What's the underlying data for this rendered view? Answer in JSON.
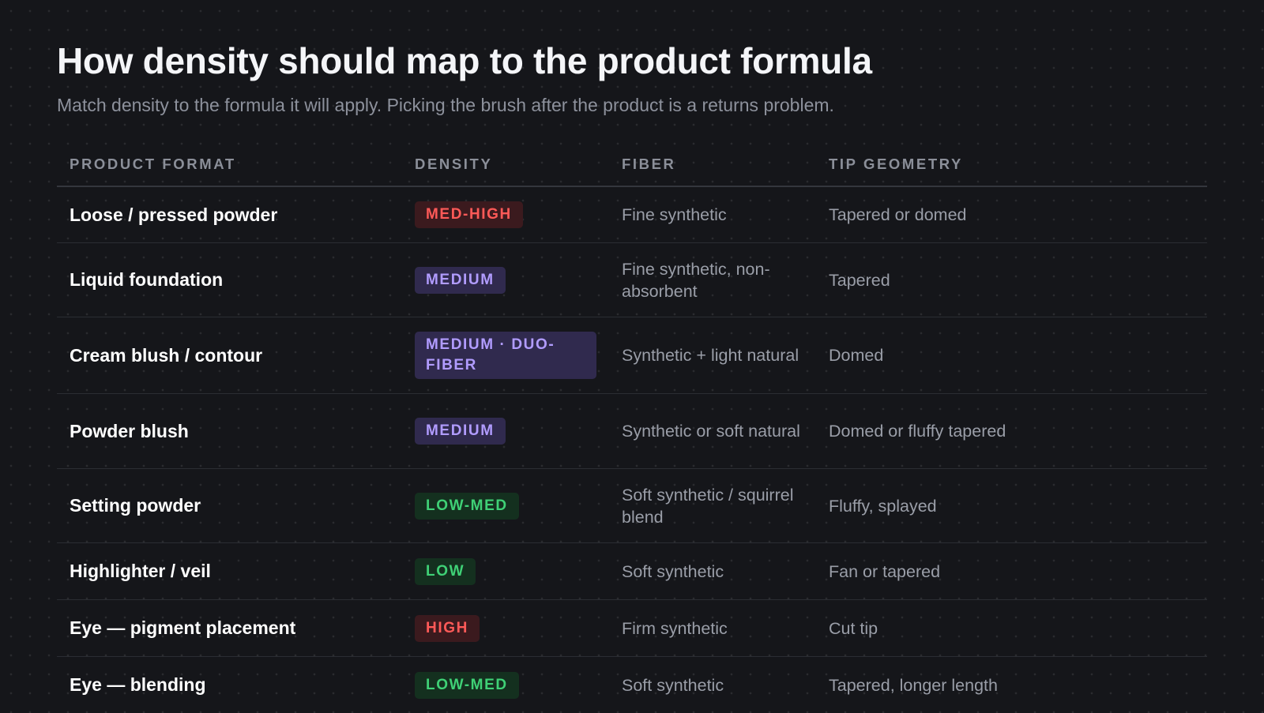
{
  "header": {
    "title": "How density should map to the product formula",
    "subtitle": "Match density to the formula it will apply. Picking the brush after the product is a returns problem."
  },
  "table": {
    "columns": [
      "PRODUCT FORMAT",
      "DENSITY",
      "FIBER",
      "TIP GEOMETRY"
    ],
    "rows": [
      {
        "format": "Loose / pressed powder",
        "density": "MED-HIGH",
        "density_color": "red",
        "fiber": "Fine synthetic",
        "tip": "Tapered or domed"
      },
      {
        "format": "Liquid foundation",
        "density": "MEDIUM",
        "density_color": "purple",
        "fiber": "Fine synthetic, non-absorbent",
        "tip": "Tapered"
      },
      {
        "format": "Cream blush / contour",
        "density": "MEDIUM · DUO-FIBER",
        "density_color": "purple",
        "fiber": "Synthetic + light natural",
        "tip": "Domed"
      },
      {
        "format": "Powder blush",
        "density": "MEDIUM",
        "density_color": "purple",
        "fiber": "Synthetic or soft natural",
        "tip": "Domed or fluffy tapered"
      },
      {
        "format": "Setting powder",
        "density": "LOW-MED",
        "density_color": "green",
        "fiber": "Soft synthetic / squirrel blend",
        "tip": "Fluffy, splayed"
      },
      {
        "format": "Highlighter / veil",
        "density": "LOW",
        "density_color": "green",
        "fiber": "Soft synthetic",
        "tip": "Fan or tapered"
      },
      {
        "format": "Eye — pigment placement",
        "density": "HIGH",
        "density_color": "red",
        "fiber": "Firm synthetic",
        "tip": "Cut tip"
      },
      {
        "format": "Eye — blending",
        "density": "LOW-MED",
        "density_color": "green",
        "fiber": "Soft synthetic",
        "tip": "Tapered, longer length"
      }
    ]
  },
  "colors": {
    "background": "#15161a",
    "red_badge_text": "#ff5a58",
    "purple_badge_text": "#b19cff",
    "green_badge_text": "#3fd176"
  }
}
